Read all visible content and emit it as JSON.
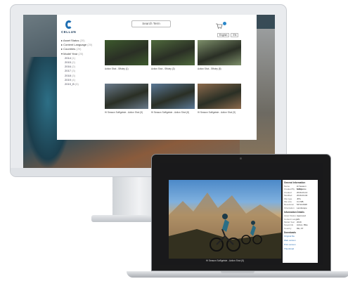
{
  "imac_page": {
    "brand": "CELLUN",
    "search_placeholder": "Search Term",
    "lang_options": [
      "English",
      "EN"
    ],
    "facets": [
      {
        "label": "▸ Asset Status",
        "count": "(20)",
        "sub": false
      },
      {
        "label": "▸ Content Language",
        "count": "(20)",
        "sub": false
      },
      {
        "label": "▸ Countries",
        "count": "(20)",
        "sub": false
      },
      {
        "label": "▾ Model Year",
        "count": "(20)",
        "sub": false
      },
      {
        "label": "2014",
        "count": "(1)",
        "sub": true
      },
      {
        "label": "2015",
        "count": "(2)",
        "sub": true
      },
      {
        "label": "2016",
        "count": "(2)",
        "sub": true
      },
      {
        "label": "2017",
        "count": "(3)",
        "sub": true
      },
      {
        "label": "2018",
        "count": "(3)",
        "sub": true
      },
      {
        "label": "2019",
        "count": "(4)",
        "sub": true
      },
      {
        "label": "2019_B",
        "count": "(5)",
        "sub": true
      }
    ],
    "thumbs": [
      {
        "caption": "Action Shot - Sffoley (1)",
        "color": "#3d5a2d"
      },
      {
        "caption": "Action Shot - Sffoley (3)",
        "color": "#4f6a3c"
      },
      {
        "caption": "Action Shot - Sffoley (8)",
        "color": "#7d8f6a"
      },
      {
        "caption": "Hi Season Sofligeiste - Action Shot (5)",
        "color": "#6a7b8c"
      },
      {
        "caption": "Hi Season Sofligeiste - Action Shot (8)",
        "color": "#5a7896"
      },
      {
        "caption": "Hi Season Sofligeiste - Action Shot (9)",
        "color": "#8c6a4c"
      }
    ]
  },
  "macbook_page": {
    "photo_caption": "Hi Season Sofligeiste - Action Shot (5)",
    "panel_title": "General Information",
    "rows": [
      {
        "k": "Name",
        "v": "Hi Season Sofligeiste"
      },
      {
        "k": "Created By",
        "v": "Admin"
      },
      {
        "k": "Created",
        "v": "2019-03-14"
      },
      {
        "k": "Modified",
        "v": "2019-04-02"
      },
      {
        "k": "File type",
        "v": "JPG"
      },
      {
        "k": "File size",
        "v": "3.4 MB"
      },
      {
        "k": "Resolution",
        "v": "5472x3648"
      },
      {
        "k": "Orientation",
        "v": "Landscape"
      }
    ],
    "section2": "Information Details",
    "rows2": [
      {
        "k": "Asset Status",
        "v": "Approved"
      },
      {
        "k": "Content Lang",
        "v": "EN"
      },
      {
        "k": "Model Year",
        "v": "2019"
      },
      {
        "k": "Keywords",
        "v": "Action, Bike"
      },
      {
        "k": "Country",
        "v": "DE, AT"
      }
    ],
    "section3": "Downloads",
    "downloads": [
      "Original file",
      "Web version",
      "Print version",
      "Thumbnail"
    ]
  }
}
